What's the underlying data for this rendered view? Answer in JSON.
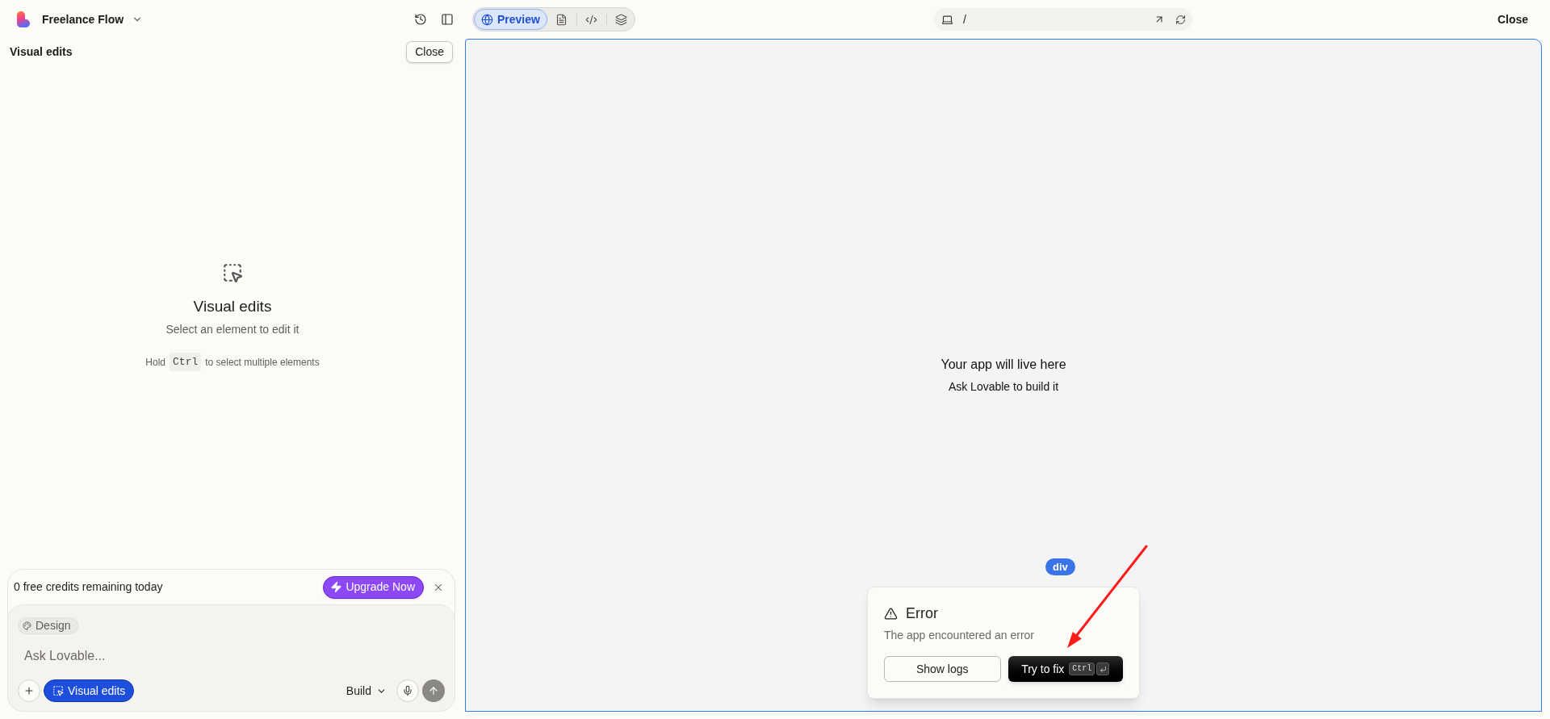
{
  "top_bar": {
    "project_name": "Freelance Flow",
    "view_tabs": [
      {
        "kind": "preview",
        "label": "Preview",
        "selected": true
      },
      {
        "kind": "files",
        "selected": false
      },
      {
        "kind": "code",
        "selected": false
      },
      {
        "kind": "layers",
        "selected": false
      }
    ],
    "url": "/",
    "close": "Close"
  },
  "side_panel": {
    "title": "Visual edits",
    "close": "Close",
    "empty_state": {
      "title": "Visual edits",
      "subtitle": "Select an element to edit it",
      "hint_before": "Hold",
      "hint_key": "Ctrl",
      "hint_after": "to select multiple elements"
    }
  },
  "chat": {
    "credits_text": "0 free credits remaining today",
    "upgrade_button": "Upgrade Now",
    "chip": "Design",
    "placeholder": "Ask Lovable...",
    "visual_edits": {
      "label": "Visual edits",
      "selected": true
    },
    "mode": "Build"
  },
  "preview": {
    "title": "Your app will live here",
    "subtitle": "Ask Lovable to build it",
    "element_badge": "div",
    "error": {
      "title": "Error",
      "message": "The app encountered an error",
      "show_logs": "Show logs",
      "try_fix": "Try to fix",
      "shortcut_key": "Ctrl"
    }
  }
}
